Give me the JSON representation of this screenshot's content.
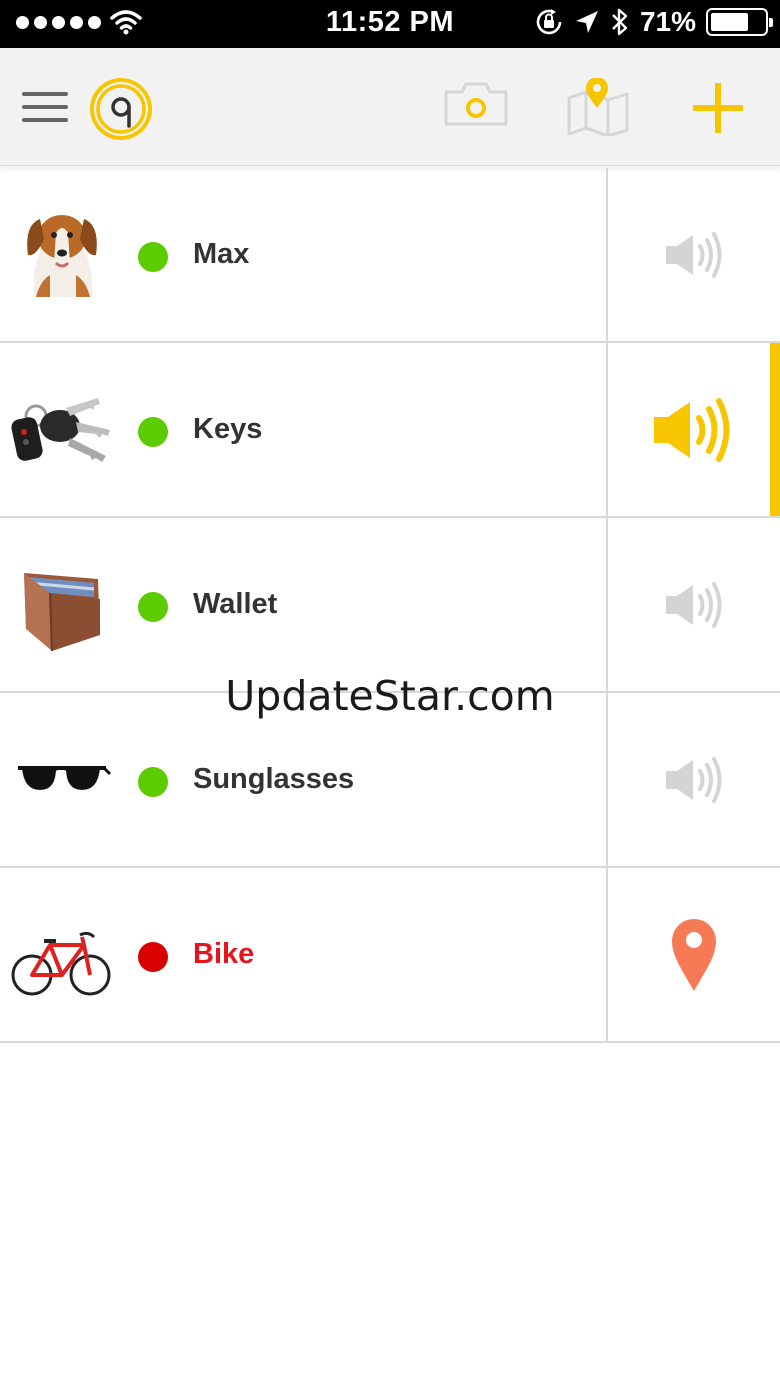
{
  "status_bar": {
    "time": "11:52 PM",
    "battery_percent": "71%",
    "battery_level": 0.71,
    "icons": [
      "signal-dots-icon",
      "wifi-icon",
      "rotation-lock-icon",
      "location-arrow-icon",
      "bluetooth-icon",
      "battery-icon"
    ]
  },
  "header": {
    "menu_icon": "hamburger-menu-icon",
    "logo_icon": "tile-logo-icon",
    "actions": [
      "camera-icon",
      "map-pin-icon",
      "plus-icon"
    ],
    "accent_color": "#f7c600"
  },
  "items": [
    {
      "name": "Max",
      "status": "in-range",
      "status_color": "#5ccc00",
      "action_icon": "speaker-icon",
      "active": false
    },
    {
      "name": "Keys",
      "status": "in-range",
      "status_color": "#5ccc00",
      "action_icon": "speaker-icon",
      "active": true
    },
    {
      "name": "Wallet",
      "status": "in-range",
      "status_color": "#5ccc00",
      "action_icon": "speaker-icon",
      "active": false
    },
    {
      "name": "Sunglasses",
      "status": "in-range",
      "status_color": "#5ccc00",
      "action_icon": "speaker-icon",
      "active": false
    },
    {
      "name": "Bike",
      "status": "lost",
      "status_color": "#d90000",
      "action_icon": "map-pin-icon",
      "active": false
    }
  ],
  "watermark": "UpdateStar.com"
}
